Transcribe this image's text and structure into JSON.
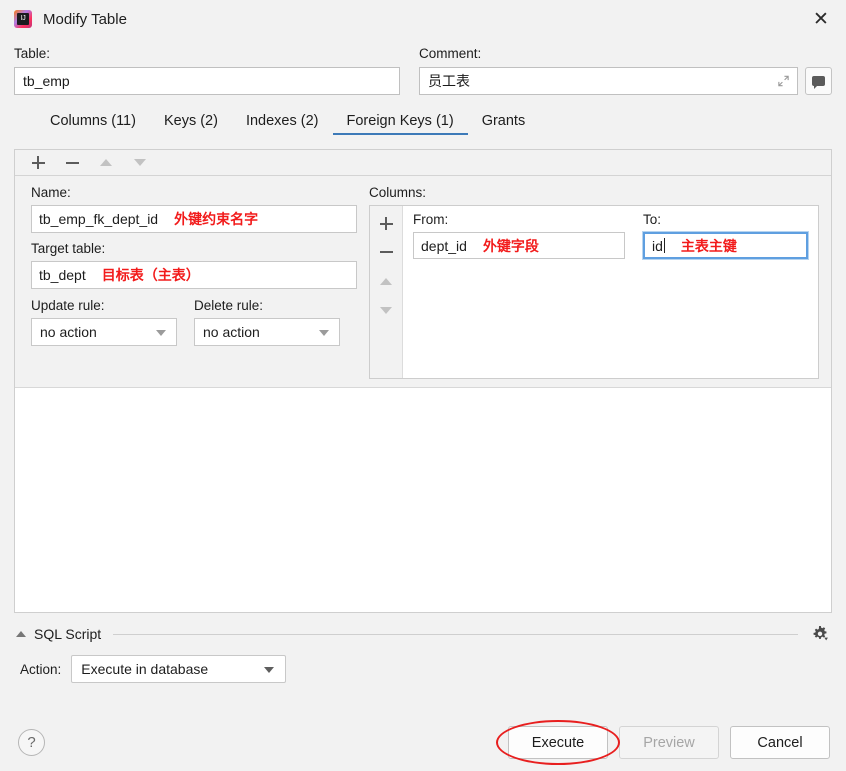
{
  "window": {
    "title": "Modify Table",
    "app_icon": "intellij-idea-icon",
    "close_label": "✕"
  },
  "top": {
    "table_label": "Table:",
    "table_value": "tb_emp",
    "comment_label": "Comment:",
    "comment_value": "员工表",
    "expand_icon": "expand-arrows-icon",
    "comment_button_icon": "speech-bubble-icon"
  },
  "tabs": [
    {
      "label": "Columns (11)",
      "active": false
    },
    {
      "label": "Keys (2)",
      "active": false
    },
    {
      "label": "Indexes (2)",
      "active": false
    },
    {
      "label": "Foreign Keys (1)",
      "active": true
    },
    {
      "label": "Grants",
      "active": false
    }
  ],
  "toolbar": {
    "add_icon": "plus-icon",
    "remove_icon": "minus-icon",
    "move_up_icon": "triangle-up-icon",
    "move_down_icon": "triangle-down-icon"
  },
  "form": {
    "name_label": "Name:",
    "name_value": "tb_emp_fk_dept_id",
    "name_annotation": "外键约束名字",
    "target_table_label": "Target table:",
    "target_table_value": "tb_dept",
    "target_table_annotation": "目标表（主表）",
    "update_rule_label": "Update rule:",
    "update_rule_value": "no action",
    "delete_rule_label": "Delete rule:",
    "delete_rule_value": "no action"
  },
  "columns": {
    "section_label": "Columns:",
    "add_icon": "plus-icon",
    "remove_icon": "minus-icon",
    "move_up_icon": "triangle-up-icon",
    "move_down_icon": "triangle-down-icon",
    "from_label": "From:",
    "from_value": "dept_id",
    "from_annotation": "外键字段",
    "to_label": "To:",
    "to_value": "id",
    "to_annotation": "主表主键"
  },
  "sql_script": {
    "title": "SQL Script",
    "collapse_icon": "triangle-up-icon",
    "settings_icon": "gear-icon",
    "action_label": "Action:",
    "action_value": "Execute in database"
  },
  "footer": {
    "help_label": "?",
    "execute_label": "Execute",
    "preview_label": "Preview",
    "cancel_label": "Cancel"
  },
  "colors": {
    "accent": "#3d7ab8",
    "annotation_red": "#f21b1b",
    "focus_border": "#5f9fe0",
    "window_bg": "#f2f2f2"
  }
}
